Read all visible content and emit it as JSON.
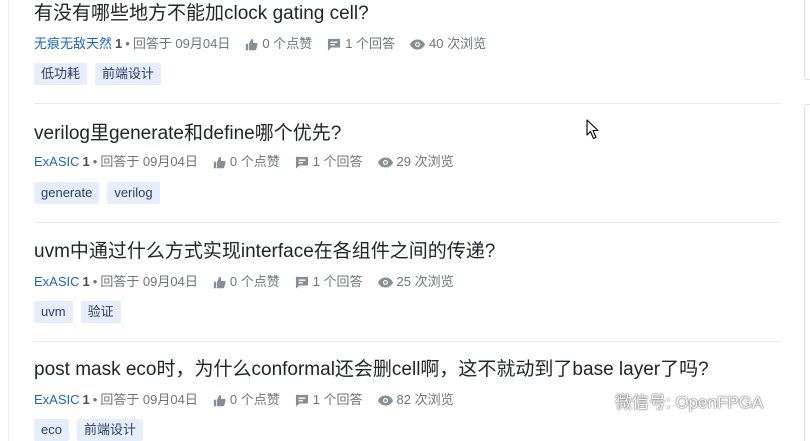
{
  "questions": [
    {
      "title": "有没有哪些地方不能加clock gating cell?",
      "author": "无痕无敌天然",
      "rep": "1",
      "answered": "回答于 09月04日",
      "likes": "0 个点赞",
      "answers": "1 个回答",
      "views": "40 次浏览",
      "tags": [
        "低功耗",
        "前端设计"
      ]
    },
    {
      "title": "verilog里generate和define哪个优先?",
      "author": "ExASIC",
      "rep": "1",
      "answered": "回答于 09月04日",
      "likes": "0 个点赞",
      "answers": "1 个回答",
      "views": "29 次浏览",
      "tags": [
        "generate",
        "verilog"
      ]
    },
    {
      "title": "uvm中通过什么方式实现interface在各组件之间的传递?",
      "author": "ExASIC",
      "rep": "1",
      "answered": "回答于 09月04日",
      "likes": "0 个点赞",
      "answers": "1 个回答",
      "views": "25 次浏览",
      "tags": [
        "uvm",
        "验证"
      ]
    },
    {
      "title": "post mask eco时，为什么conformal还会删cell啊，这不就动到了base layer了吗?",
      "author": "ExASIC",
      "rep": "1",
      "answered": "回答于 09月04日",
      "likes": "0 个点赞",
      "answers": "1 个回答",
      "views": "82 次浏览",
      "tags": [
        "eco",
        "前端设计"
      ]
    }
  ],
  "meta_separator": "•",
  "icons": {
    "likes": "thumbs-up-icon",
    "answers": "comment-icon",
    "views": "eye-icon",
    "watermark": "wechat-icon",
    "cursor": "mouse-pointer-icon"
  },
  "colors": {
    "author": "#1d64c8",
    "meta": "#6c757d",
    "tag_bg": "#e7eefb",
    "tag_text": "#2a3f66",
    "title": "#212529"
  },
  "watermark": {
    "text": "微信号: OpenFPGA"
  }
}
